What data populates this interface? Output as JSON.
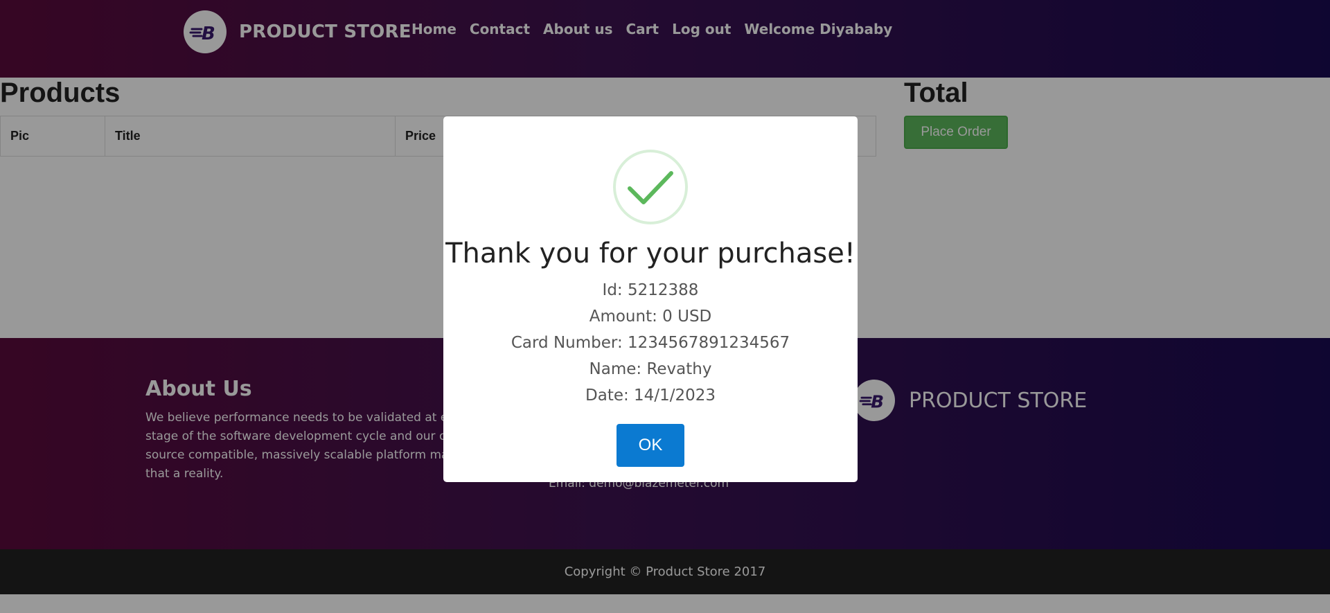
{
  "navbar": {
    "brand": "PRODUCT STORE",
    "links": [
      "Home",
      "Contact",
      "About us",
      "Cart",
      "Log out",
      "Welcome Diyababy"
    ]
  },
  "products": {
    "title": "Products",
    "columns": [
      "Pic",
      "Title",
      "Price"
    ]
  },
  "total": {
    "title": "Total",
    "place_order_label": "Place Order"
  },
  "footer": {
    "about_title": "About Us",
    "about_text": "We believe performance needs to be validated at every stage of the software development cycle and our open source compatible, massively scalable platform makes that a reality.",
    "contact_email": "Email: demo@blazemeter.com",
    "brand": "PRODUCT STORE",
    "copyright": "Copyright © Product Store 2017"
  },
  "modal": {
    "title": "Thank you for your purchase!",
    "lines": [
      "Id: 5212388",
      "Amount: 0 USD",
      "Card Number: 1234567891234567",
      "Name: Revathy",
      "Date: 14/1/2023"
    ],
    "ok_label": "OK",
    "icon": "success-check-icon"
  },
  "colors": {
    "gradient_start": "#5b0a3c",
    "gradient_end": "#1a0a52",
    "success_green": "#5cb85c",
    "ok_blue": "#0b7ad1"
  }
}
